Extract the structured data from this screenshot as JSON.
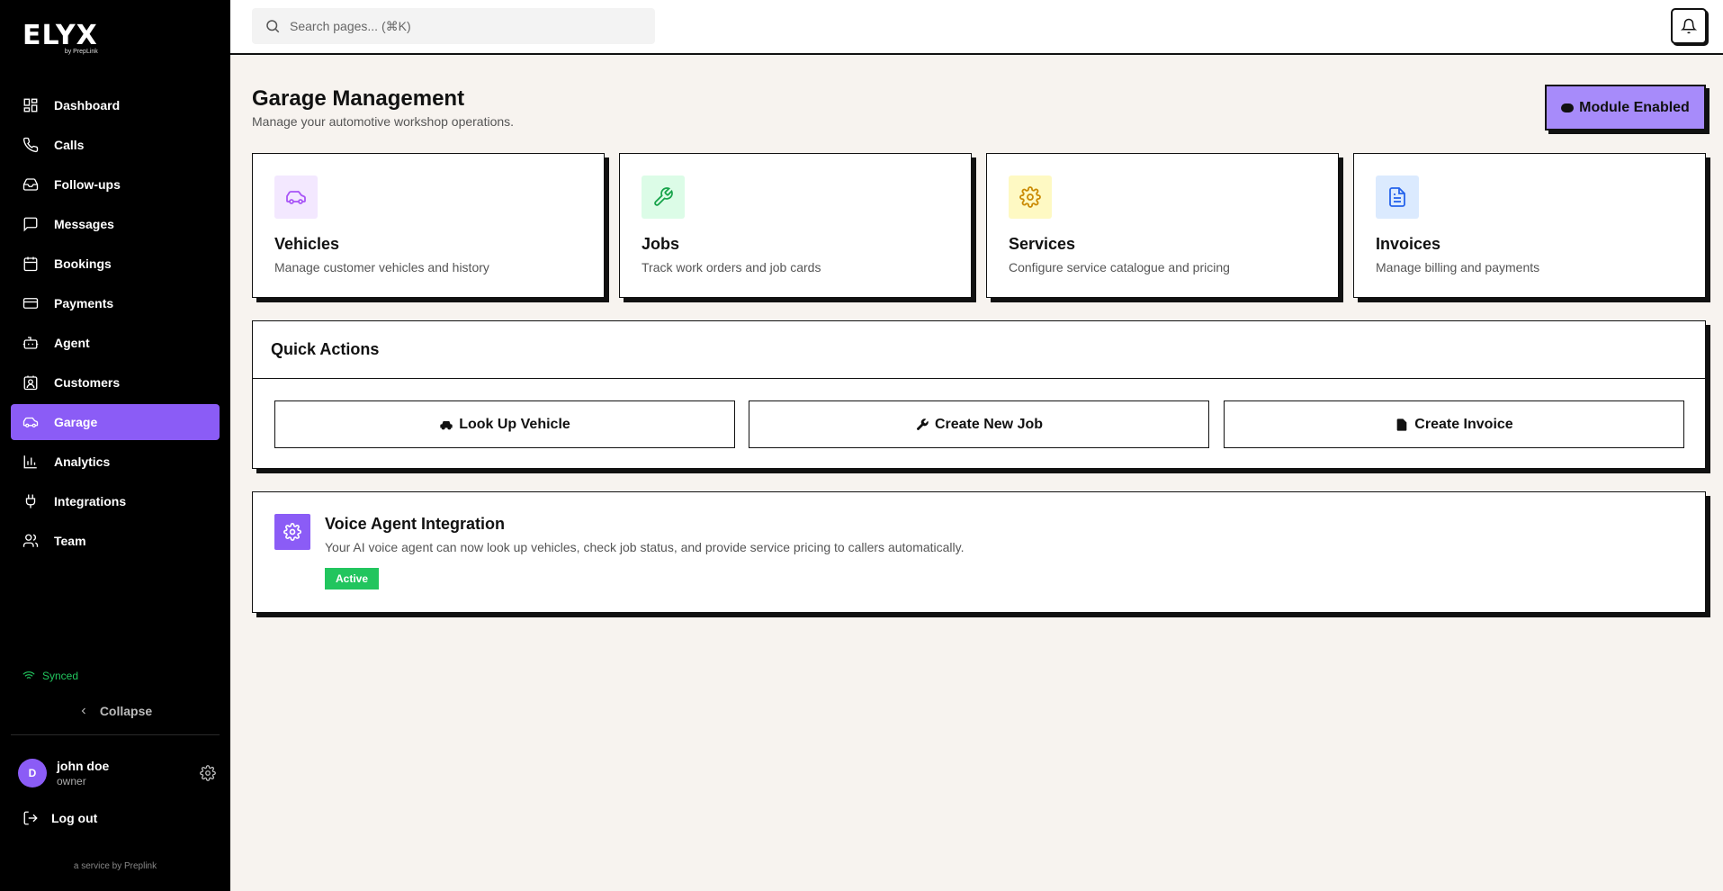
{
  "brand": {
    "logo": "ELYX",
    "logo_sub": "by PrepLink"
  },
  "sidebar": {
    "items": [
      {
        "label": "Dashboard",
        "icon": "dashboard-icon"
      },
      {
        "label": "Calls",
        "icon": "phone-icon"
      },
      {
        "label": "Follow-ups",
        "icon": "inbox-icon"
      },
      {
        "label": "Messages",
        "icon": "message-icon"
      },
      {
        "label": "Bookings",
        "icon": "calendar-icon"
      },
      {
        "label": "Payments",
        "icon": "credit-card-icon"
      },
      {
        "label": "Agent",
        "icon": "bot-icon"
      },
      {
        "label": "Customers",
        "icon": "contact-icon"
      },
      {
        "label": "Garage",
        "icon": "car-icon",
        "active": true
      },
      {
        "label": "Analytics",
        "icon": "bar-chart-icon"
      },
      {
        "label": "Integrations",
        "icon": "plug-icon"
      },
      {
        "label": "Team",
        "icon": "users-icon"
      }
    ],
    "synced": "Synced",
    "collapse": "Collapse",
    "user": {
      "initial": "D",
      "name": "john doe",
      "role": "owner"
    },
    "logout": "Log out",
    "footer": "a service by Preplink"
  },
  "search": {
    "placeholder": "Search pages... (⌘K)"
  },
  "page": {
    "title": "Garage Management",
    "subtitle": "Manage your automotive workshop operations.",
    "module_button": "Module Enabled"
  },
  "cards": [
    {
      "title": "Vehicles",
      "desc": "Manage customer vehicles and history",
      "icon": "car-icon",
      "bg": "#f3e8ff",
      "fg": "#a855f7"
    },
    {
      "title": "Jobs",
      "desc": "Track work orders and job cards",
      "icon": "wrench-icon",
      "bg": "#dcfce7",
      "fg": "#16a34a"
    },
    {
      "title": "Services",
      "desc": "Configure service catalogue and pricing",
      "icon": "gear-icon",
      "bg": "#fef9c3",
      "fg": "#ca8a04"
    },
    {
      "title": "Invoices",
      "desc": "Manage billing and payments",
      "icon": "document-icon",
      "bg": "#dbeafe",
      "fg": "#2563eb"
    }
  ],
  "quick_actions": {
    "title": "Quick Actions",
    "buttons": [
      {
        "label": "Look Up Vehicle",
        "icon": "car-icon"
      },
      {
        "label": "Create New Job",
        "icon": "wrench-icon"
      },
      {
        "label": "Create Invoice",
        "icon": "document-icon"
      }
    ]
  },
  "voice": {
    "title": "Voice Agent Integration",
    "desc": "Your AI voice agent can now look up vehicles, check job status, and provide service pricing to callers automatically.",
    "badge": "Active"
  },
  "colors": {
    "accent": "#8b5cf6",
    "accent_light": "#a78bfa",
    "success": "#22c55e",
    "background": "#f7f3ef"
  }
}
